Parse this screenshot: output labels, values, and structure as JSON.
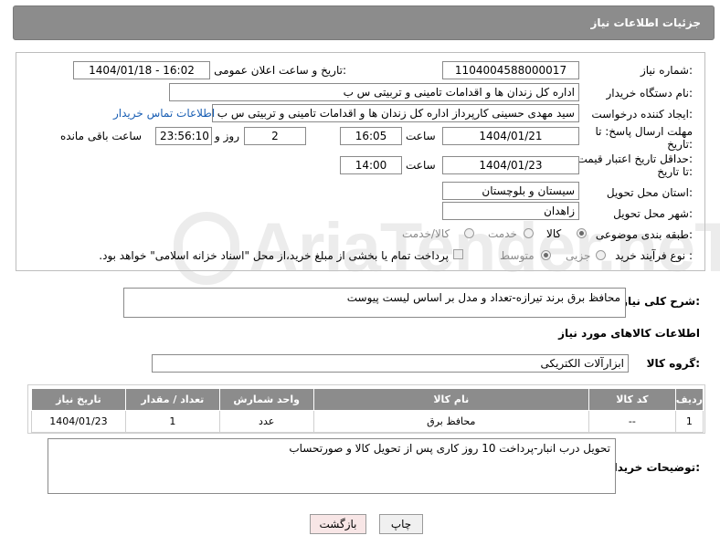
{
  "header": {
    "title": "جزئیات اطلاعات نیاز"
  },
  "form": {
    "need_number_label": "شماره نیاز:",
    "need_number": "1104004588000017",
    "announce_label": "تاریخ و ساعت اعلان عمومی:",
    "announce_value": "1404/01/18 - 16:02",
    "buyer_org_label": "نام دستگاه خریدار:",
    "buyer_org": "اداره کل زندان ها و اقدامات تامینی و تربیتی س ب",
    "creator_label": "ایجاد کننده درخواست:",
    "creator": "سید مهدی حسینی کارپرداز اداره کل زندان ها و اقدامات تامینی و تربیتی س ب",
    "contact_link": "اطلاعات تماس خریدار",
    "deadline_label_1": "مهلت ارسال پاسخ: تا",
    "deadline_label_2": "تاریخ:",
    "deadline_date": "1404/01/21",
    "time_label": "ساعت",
    "deadline_time": "16:05",
    "days_value": "2",
    "days_label": "روز و",
    "remaining_time": "23:56:10",
    "remaining_label": "ساعت باقی مانده",
    "min_price_label_1": "حداقل تاریخ اعتبار قیمت:",
    "min_price_label_2": "تا تاریخ:",
    "validity_date": "1404/01/23",
    "validity_time": "14:00",
    "province_label": "استان محل تحویل:",
    "province": "سیستان و بلوچستان",
    "city_label": "شهر محل تحویل:",
    "city": "زاهدان",
    "category_label": "طبقه بندی موضوعی:",
    "category_options": [
      "کالا",
      "خدمت",
      "کالا/خدمت"
    ],
    "category_selected": "کالا",
    "process_label": "نوع فرآیند خرید :",
    "process_options": [
      "جزیی",
      "متوسط"
    ],
    "process_selected": "متوسط",
    "payment_note": "پرداخت تمام یا بخشی از مبلغ خرید،از محل \"اسناد خزانه اسلامی\" خواهد بود."
  },
  "summary": {
    "label": "شرح کلی نیاز:",
    "text": "محافظ برق برند تیرازه-تعداد و مدل بر اساس لیست پیوست"
  },
  "goods": {
    "section_title": "اطلاعات کالاهای مورد نیاز",
    "group_label": "گروه کالا:",
    "group_value": "ابزارآلات الکتریکی",
    "columns": [
      "ردیف",
      "کد کالا",
      "نام کالا",
      "واحد شمارش",
      "تعداد / مقدار",
      "تاریخ نیاز"
    ],
    "rows": [
      [
        "1",
        "--",
        "محافظ برق",
        "عدد",
        "1",
        "1404/01/23"
      ]
    ]
  },
  "buyer_notes": {
    "label": "توضیحات خریدار:",
    "text": "تحویل درب انبار-پرداخت 10 روز کاری پس از تحویل کالا و صورتحساب"
  },
  "buttons": {
    "print": "چاپ",
    "back": "بازگشت"
  },
  "watermark": "AriaTender.neT"
}
